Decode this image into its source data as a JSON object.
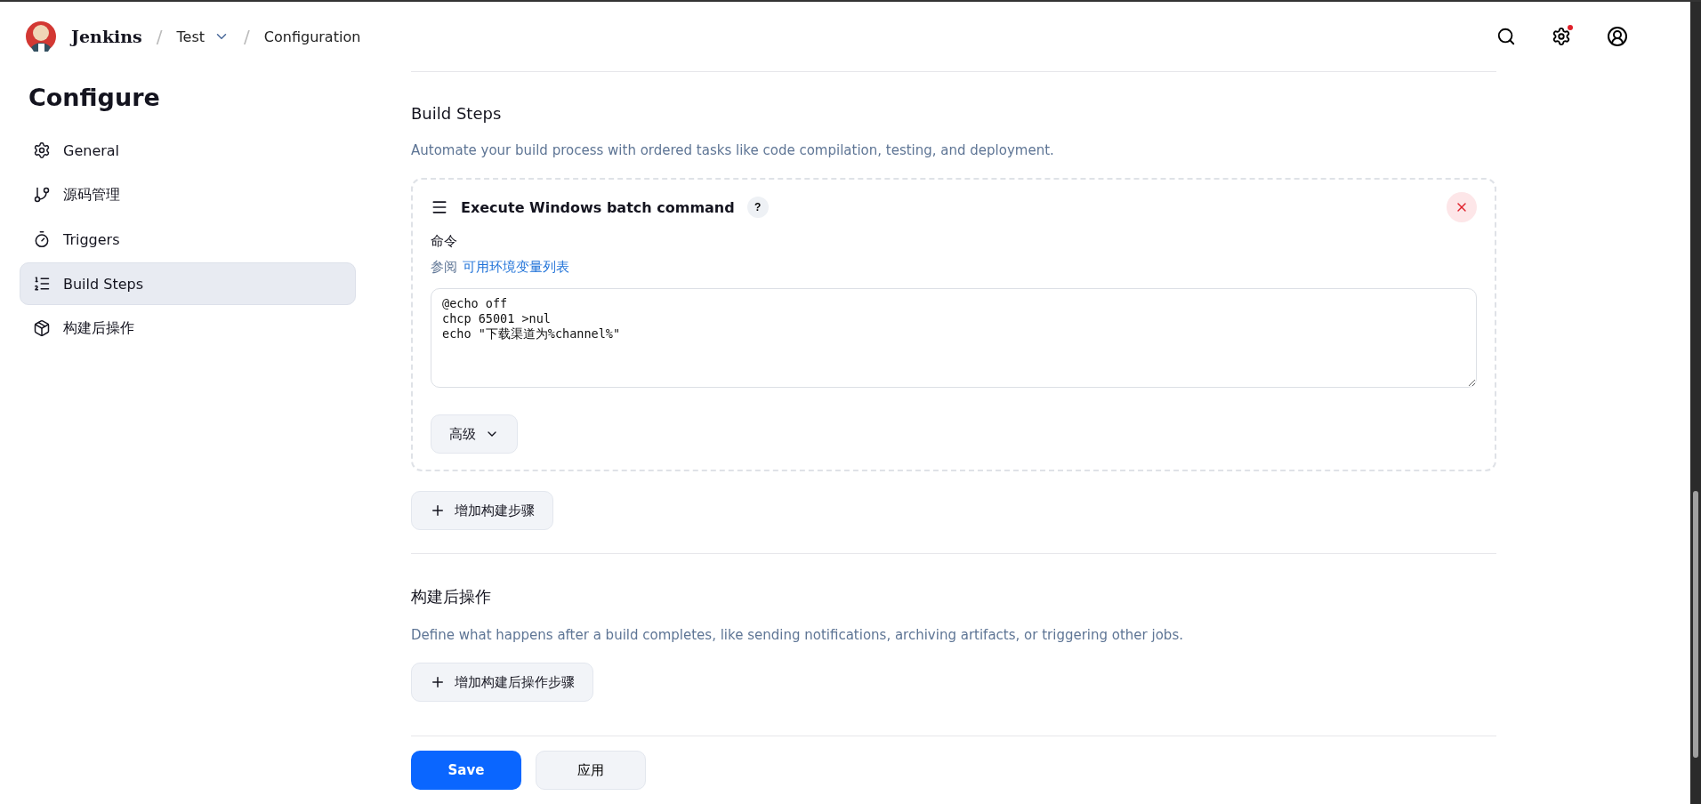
{
  "header": {
    "brand": "Jenkins",
    "separator": "/",
    "breadcrumbs": [
      {
        "label": "Test",
        "dropdown": true
      },
      {
        "label": "Configuration",
        "dropdown": false
      }
    ],
    "settings_notification": true
  },
  "sidebar": {
    "title": "Configure",
    "items": [
      {
        "label": "General",
        "selected": false
      },
      {
        "label": "源码管理",
        "selected": false
      },
      {
        "label": "Triggers",
        "selected": false
      },
      {
        "label": "Build Steps",
        "selected": true
      },
      {
        "label": "构建后操作",
        "selected": false
      }
    ]
  },
  "sections": [
    {
      "title": "Build Steps",
      "description": "Automate your build process with ordered tasks like code compilation, testing, and deployment.",
      "steps": [
        {
          "title": "Execute Windows batch command",
          "help": "?",
          "field_label": "命令",
          "hint_prefix": "参阅",
          "hint_link": "可用环境变量列表",
          "value": "@echo off\nchcp 65001 >nul\necho \"下载渠道为%channel%\"",
          "advanced": "高级"
        }
      ],
      "add_button": "增加构建步骤"
    },
    {
      "title": "构建后操作",
      "description": "Define what happens after a build completes, like sending notifications, archiving artifacts, or triggering other jobs.",
      "add_button": "增加构建后操作步骤"
    }
  ],
  "footer": {
    "save": "Save",
    "apply": "应用"
  }
}
